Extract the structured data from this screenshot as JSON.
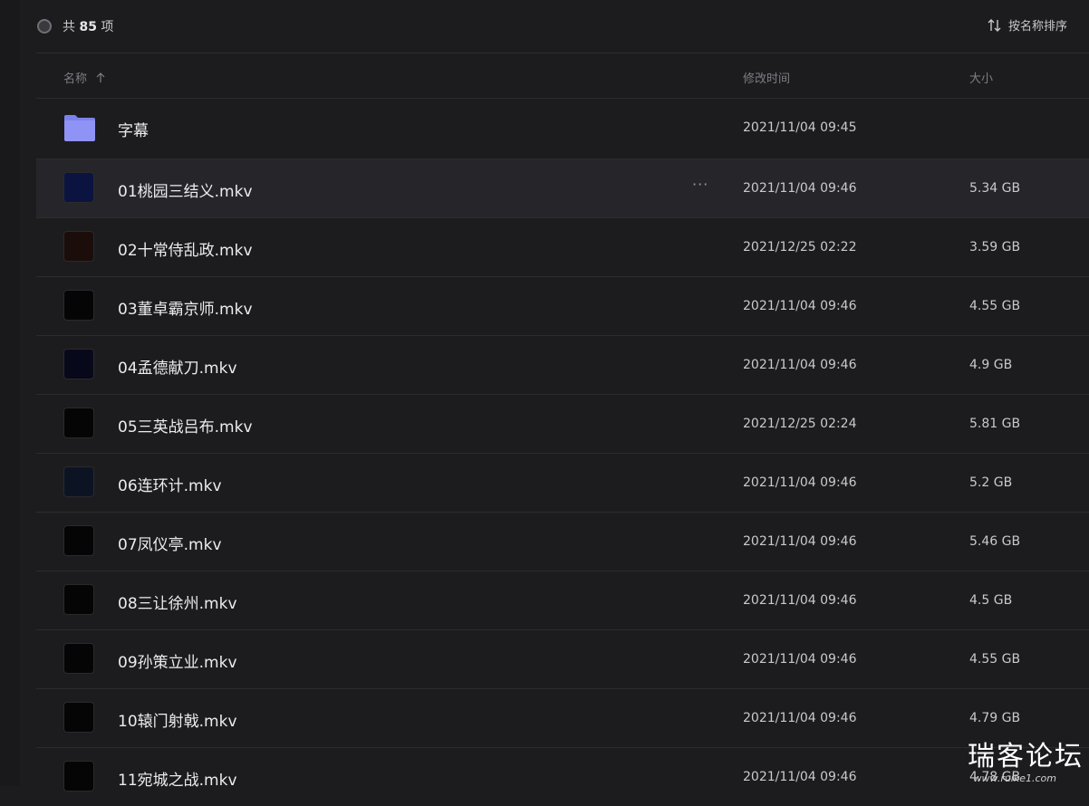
{
  "topbar": {
    "count_prefix": "共",
    "count_value": "85",
    "count_suffix": "项",
    "sort_label": "按名称排序"
  },
  "columns": {
    "name": "名称",
    "modified": "修改时间",
    "size": "大小"
  },
  "rows": [
    {
      "type": "folder",
      "name": "字幕",
      "modified": "2021/11/04 09:45",
      "size": ""
    },
    {
      "type": "video",
      "name": "01桃园三结义.mkv",
      "modified": "2021/11/04 09:46",
      "size": "5.34 GB",
      "thumb_color": "#0b1440",
      "hover": true
    },
    {
      "type": "video",
      "name": "02十常侍乱政.mkv",
      "modified": "2021/12/25 02:22",
      "size": "3.59 GB",
      "thumb_color": "#1a0d0a"
    },
    {
      "type": "video",
      "name": "03董卓霸京师.mkv",
      "modified": "2021/11/04 09:46",
      "size": "4.55 GB",
      "thumb_color": "#050506"
    },
    {
      "type": "video",
      "name": "04孟德献刀.mkv",
      "modified": "2021/11/04 09:46",
      "size": "4.9 GB",
      "thumb_color": "#07081a"
    },
    {
      "type": "video",
      "name": "05三英战吕布.mkv",
      "modified": "2021/12/25 02:24",
      "size": "5.81 GB",
      "thumb_color": "#050506"
    },
    {
      "type": "video",
      "name": "06连环计.mkv",
      "modified": "2021/11/04 09:46",
      "size": "5.2 GB",
      "thumb_color": "#0c1424"
    },
    {
      "type": "video",
      "name": "07凤仪亭.mkv",
      "modified": "2021/11/04 09:46",
      "size": "5.46 GB",
      "thumb_color": "#050506"
    },
    {
      "type": "video",
      "name": "08三让徐州.mkv",
      "modified": "2021/11/04 09:46",
      "size": "4.5 GB",
      "thumb_color": "#050506"
    },
    {
      "type": "video",
      "name": "09孙策立业.mkv",
      "modified": "2021/11/04 09:46",
      "size": "4.55 GB",
      "thumb_color": "#050506"
    },
    {
      "type": "video",
      "name": "10辕门射戟.mkv",
      "modified": "2021/11/04 09:46",
      "size": "4.79 GB",
      "thumb_color": "#050506"
    },
    {
      "type": "video",
      "name": "11宛城之战.mkv",
      "modified": "2021/11/04 09:46",
      "size": "4.78 GB",
      "thumb_color": "#050506"
    }
  ],
  "watermark": {
    "text": "瑞客论坛",
    "sub": "www.ruike1.com"
  },
  "colors": {
    "background": "#1c1c1f",
    "hover_row": "#26262a",
    "folder": "#8f93f5"
  }
}
